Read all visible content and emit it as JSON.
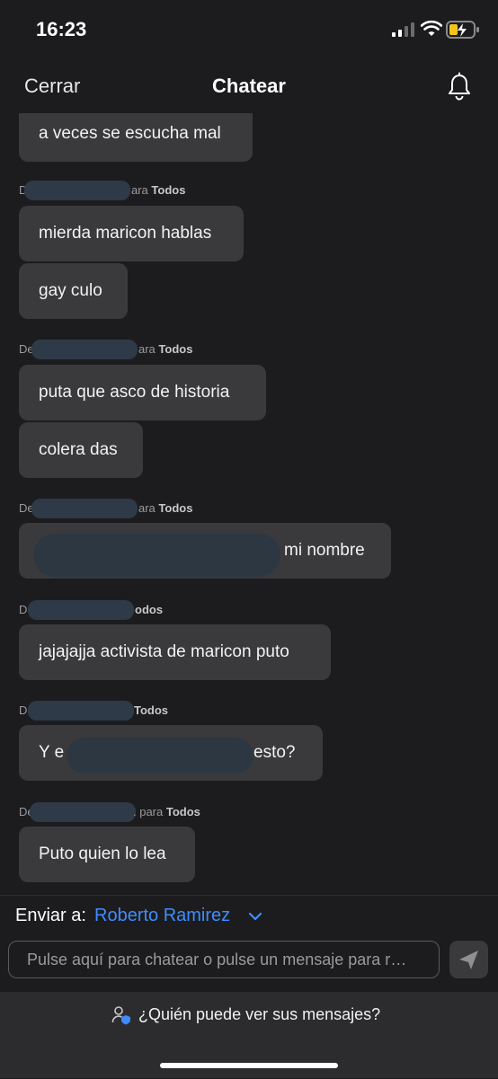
{
  "status_bar": {
    "time": "16:23"
  },
  "nav": {
    "close_label": "Cerrar",
    "title": "Chatear",
    "bell_icon": "bell-icon"
  },
  "messages": [
    {
      "bubble": "a veces se escucha mal"
    },
    {
      "sender_prefix": "De",
      "sender_suffix": "ara",
      "audience": "Todos",
      "bubbles": [
        "mierda maricon hablas",
        "gay culo"
      ]
    },
    {
      "sender_prefix": "De",
      "sender_suffix": "ara",
      "audience": "Todos",
      "bubbles": [
        "puta que asco de historia",
        "colera das"
      ]
    },
    {
      "sender_prefix": "De",
      "sender_suffix": "ara",
      "audience": "Todos",
      "bubble_tail": "mi nombre"
    },
    {
      "sender_prefix": "De",
      "audience": "odos",
      "bubble": "jajajajja activista de maricon puto"
    },
    {
      "sender_prefix": "De",
      "audience": "Todos",
      "bubble_head": "Y e",
      "bubble_tail": "esto?"
    },
    {
      "sender_prefix": "De",
      "sender_suffix": ". para",
      "audience": "Todos",
      "bubble": "Puto quien lo lea"
    }
  ],
  "composer": {
    "send_to_label": "Enviar a:",
    "recipient": "Roberto Ramirez",
    "placeholder": "Pulse aquí para chatear o pulse un mensaje para r…"
  },
  "footer": {
    "who_can_see": "¿Quién puede ver sus mensajes?"
  },
  "colors": {
    "background": "#1c1c1e",
    "bubble": "#3a3a3c",
    "accent": "#3e8cff"
  }
}
